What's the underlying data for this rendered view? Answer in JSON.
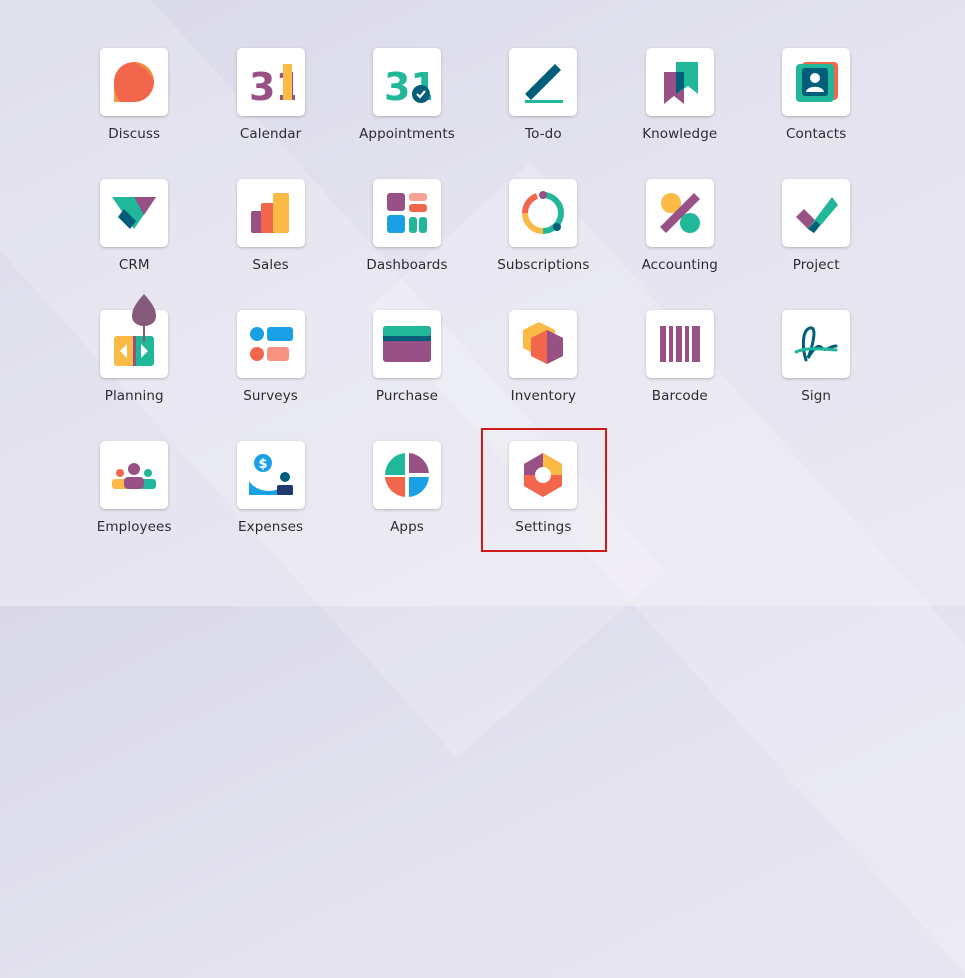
{
  "apps": [
    {
      "label": "Discuss",
      "icon": "discuss-icon"
    },
    {
      "label": "Calendar",
      "icon": "calendar-icon",
      "icon_text": "31"
    },
    {
      "label": "Appointments",
      "icon": "appointments-icon",
      "icon_text": "31"
    },
    {
      "label": "To-do",
      "icon": "todo-icon"
    },
    {
      "label": "Knowledge",
      "icon": "knowledge-icon"
    },
    {
      "label": "Contacts",
      "icon": "contacts-icon"
    },
    {
      "label": "CRM",
      "icon": "crm-icon"
    },
    {
      "label": "Sales",
      "icon": "sales-icon"
    },
    {
      "label": "Dashboards",
      "icon": "dashboards-icon"
    },
    {
      "label": "Subscriptions",
      "icon": "subscriptions-icon"
    },
    {
      "label": "Accounting",
      "icon": "accounting-icon"
    },
    {
      "label": "Project",
      "icon": "project-icon"
    },
    {
      "label": "Planning",
      "icon": "planning-icon"
    },
    {
      "label": "Surveys",
      "icon": "surveys-icon"
    },
    {
      "label": "Purchase",
      "icon": "purchase-icon"
    },
    {
      "label": "Inventory",
      "icon": "inventory-icon"
    },
    {
      "label": "Barcode",
      "icon": "barcode-icon"
    },
    {
      "label": "Sign",
      "icon": "sign-icon"
    },
    {
      "label": "Employees",
      "icon": "employees-icon"
    },
    {
      "label": "Expenses",
      "icon": "expenses-icon",
      "icon_text": "$"
    },
    {
      "label": "Apps",
      "icon": "apps-icon"
    },
    {
      "label": "Settings",
      "icon": "settings-icon"
    }
  ],
  "highlighted_app": "Settings",
  "colors": {
    "purple": "#985184",
    "teal": "#21b799",
    "orange": "#f2664b",
    "yellow": "#fbb945",
    "blue": "#1aa1e5",
    "dark_teal": "#005e7a",
    "highlight_border": "#d0191b"
  }
}
